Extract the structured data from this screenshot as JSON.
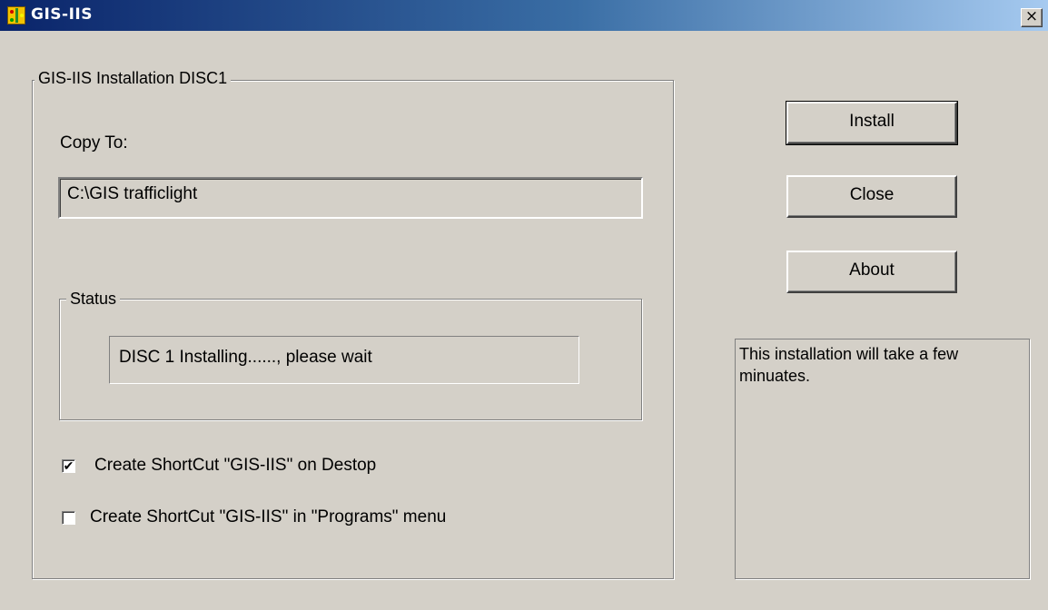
{
  "window": {
    "title": "GIS-IIS",
    "close_label": "×"
  },
  "install_group": {
    "legend": "GIS-IIS Installation DISC1",
    "copy_to_label": "Copy To:",
    "copy_to_value": "C:\\GIS trafficlight"
  },
  "status_group": {
    "legend": "Status",
    "status_text": "DISC 1 Installing......, please wait"
  },
  "options": {
    "desktop_shortcut": {
      "label": "Create ShortCut \"GIS-IIS\" on Destop",
      "checked": true,
      "check_mark": "✔"
    },
    "programs_shortcut": {
      "label": "Create ShortCut \"GIS-IIS\" in \"Programs\" menu",
      "checked": false,
      "check_mark": ""
    }
  },
  "buttons": {
    "install": "Install",
    "close": "Close",
    "about": "About"
  },
  "info": {
    "text": "This installation will take a few minuates."
  },
  "colors": {
    "titlebar_start": "#0a246a",
    "titlebar_end": "#a6caf0",
    "face": "#d4d0c8"
  },
  "icons": {
    "app": "traffic-light-icon",
    "close": "close-icon"
  }
}
